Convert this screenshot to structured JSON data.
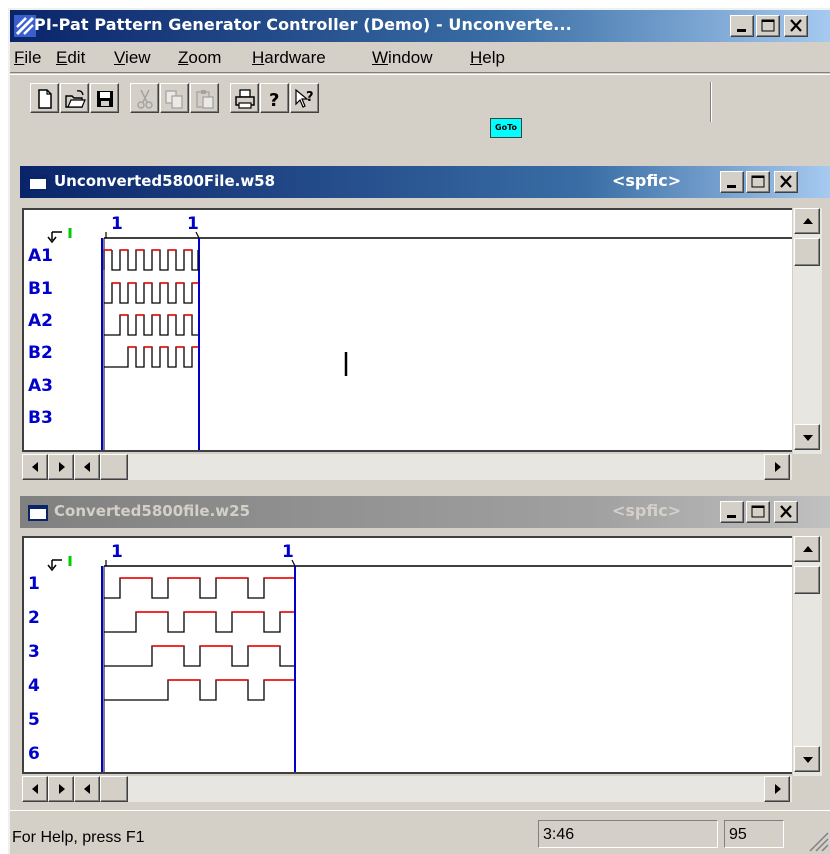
{
  "app": {
    "title": "PI-Pat Pattern Generator Controller (Demo) - Unconverte...",
    "logo_icon": "pi-pat-logo-icon"
  },
  "menu": [
    {
      "label": "File",
      "accel": "F",
      "rest": "ile"
    },
    {
      "label": "Edit",
      "accel": "E",
      "rest": "dit"
    },
    {
      "label": "View",
      "accel": "V",
      "rest": "iew"
    },
    {
      "label": "Zoom",
      "accel": "Z",
      "rest": "oom"
    },
    {
      "label": "Hardware",
      "accel": "H",
      "rest": "ardware"
    },
    {
      "label": "Window",
      "accel": "W",
      "rest": "indow"
    },
    {
      "label": "Help",
      "accel": "H",
      "rest": "elp"
    }
  ],
  "toolbar": {
    "buttons": [
      "new-icon",
      "open-icon",
      "save-icon",
      "cut-icon",
      "copy-icon",
      "paste-icon",
      "print-icon",
      "help-icon",
      "context-help-icon"
    ],
    "goto_label": "GoTo",
    "goto_color": "#00ffff"
  },
  "windows": [
    {
      "name": "Unconverted5800File.w58",
      "tag": "<spfic>",
      "active": true,
      "marker_start": "1",
      "marker_end": "1",
      "tracks": [
        "A1",
        "B1",
        "A2",
        "B2",
        "A3",
        "B3"
      ]
    },
    {
      "name": "Converted5800file.w25",
      "tag": "<spfic>",
      "active": false,
      "marker_start": "1",
      "marker_end": "1",
      "tracks": [
        "1",
        "2",
        "3",
        "4",
        "5",
        "6"
      ]
    }
  ],
  "status": {
    "help_text": "For Help, press F1",
    "position": "3:46",
    "zoom": "95"
  },
  "colors": {
    "track_label": "#0000cc",
    "signal_high": "#ff0000",
    "signal_low": "#000000",
    "marker_line": "#0000cc"
  }
}
